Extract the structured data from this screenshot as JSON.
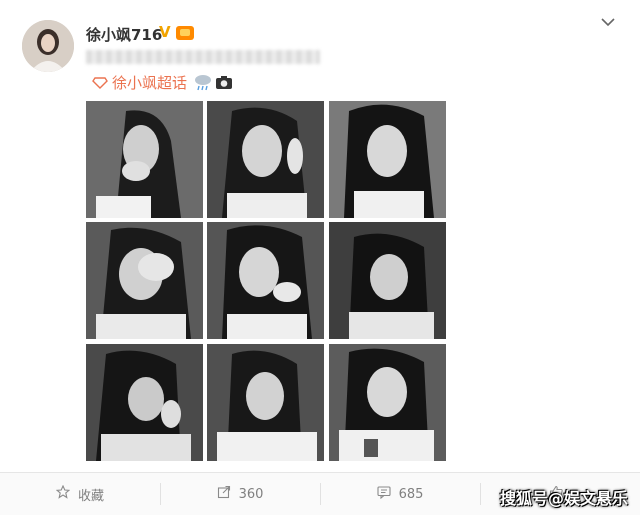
{
  "user": {
    "name": "徐小飒716"
  },
  "post": {
    "topic_label": "徐小飒超话",
    "photos": [
      {
        "id": 1
      },
      {
        "id": 2
      },
      {
        "id": 3
      },
      {
        "id": 4
      },
      {
        "id": 5
      },
      {
        "id": 6
      },
      {
        "id": 7
      },
      {
        "id": 8
      },
      {
        "id": 9
      }
    ]
  },
  "footer": {
    "favorite_label": "收藏",
    "repost_count": "360",
    "comment_count": "685"
  },
  "watermark": "搜狐号@娱文悬乐",
  "colors": {
    "topic": "#eb7350",
    "verified": "#f2a400",
    "muted": "#808080"
  },
  "icons": {
    "verified": "verified-v-icon",
    "vip": "vip-badge-icon",
    "topic": "super-topic-icon",
    "favorite": "star-icon",
    "repost": "repost-icon",
    "comment": "comment-icon"
  }
}
